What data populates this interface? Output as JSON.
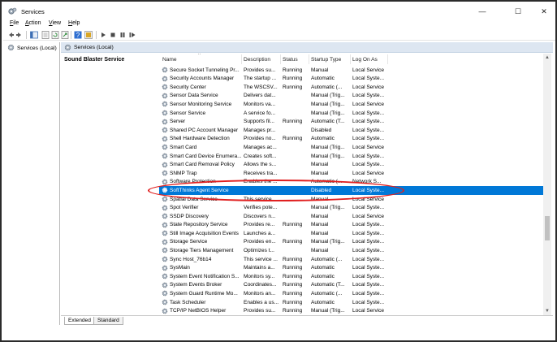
{
  "window": {
    "title": "Services",
    "controls": {
      "minimize": "—",
      "maximize": "☐",
      "close": "✕"
    }
  },
  "menu": [
    {
      "label": "File",
      "key": "F",
      "rest": "ile"
    },
    {
      "label": "Action",
      "key": "A",
      "rest": "ction"
    },
    {
      "label": "View",
      "key": "V",
      "rest": "iew"
    },
    {
      "label": "Help",
      "key": "H",
      "rest": "elp"
    }
  ],
  "tree": {
    "item": "Services (Local)"
  },
  "header_band": {
    "label": "Services (Local)"
  },
  "selected_service_title": "Sound Blaster Service",
  "columns": {
    "name": "Name",
    "description": "Description",
    "status": "Status",
    "startup_type": "Startup Type",
    "log_on_as": "Log On As"
  },
  "rows": [
    {
      "name": "Secure Socket Tunneling Pr...",
      "description": "Provides su...",
      "status": "Running",
      "startup": "Manual",
      "logon": "Local Service"
    },
    {
      "name": "Security Accounts Manager",
      "description": "The startup ...",
      "status": "Running",
      "startup": "Automatic",
      "logon": "Local Syste..."
    },
    {
      "name": "Security Center",
      "description": "The WSCSV...",
      "status": "Running",
      "startup": "Automatic (...",
      "logon": "Local Service"
    },
    {
      "name": "Sensor Data Service",
      "description": "Delivers dat...",
      "status": "",
      "startup": "Manual (Trig...",
      "logon": "Local Syste..."
    },
    {
      "name": "Sensor Monitoring Service",
      "description": "Monitors va...",
      "status": "",
      "startup": "Manual (Trig...",
      "logon": "Local Service"
    },
    {
      "name": "Sensor Service",
      "description": "A service fo...",
      "status": "",
      "startup": "Manual (Trig...",
      "logon": "Local Syste..."
    },
    {
      "name": "Server",
      "description": "Supports fil...",
      "status": "Running",
      "startup": "Automatic (T...",
      "logon": "Local Syste..."
    },
    {
      "name": "Shared PC Account Manager",
      "description": "Manages pr...",
      "status": "",
      "startup": "Disabled",
      "logon": "Local Syste..."
    },
    {
      "name": "Shell Hardware Detection",
      "description": "Provides no...",
      "status": "Running",
      "startup": "Automatic",
      "logon": "Local Syste..."
    },
    {
      "name": "Smart Card",
      "description": "Manages ac...",
      "status": "",
      "startup": "Manual (Trig...",
      "logon": "Local Service"
    },
    {
      "name": "Smart Card Device Enumera...",
      "description": "Creates soft...",
      "status": "",
      "startup": "Manual (Trig...",
      "logon": "Local Syste..."
    },
    {
      "name": "Smart Card Removal Policy",
      "description": "Allows the s...",
      "status": "",
      "startup": "Manual",
      "logon": "Local Syste..."
    },
    {
      "name": "SNMP Trap",
      "description": "Receives tra...",
      "status": "",
      "startup": "Manual",
      "logon": "Local Service"
    },
    {
      "name": "Software Protection",
      "description": "Enables the ...",
      "status": "",
      "startup": "Automatic (...",
      "logon": "Network S..."
    },
    {
      "name": "SoftThinks Agent Service",
      "description": "",
      "status": "",
      "startup": "Disabled",
      "logon": "Local Syste...",
      "selected": true
    },
    {
      "name": "Spatial Data Service",
      "description": "This service ...",
      "status": "",
      "startup": "Manual",
      "logon": "Local Service"
    },
    {
      "name": "Spot Verifier",
      "description": "Verifies pote...",
      "status": "",
      "startup": "Manual (Trig...",
      "logon": "Local Syste..."
    },
    {
      "name": "SSDP Discovery",
      "description": "Discovers n...",
      "status": "",
      "startup": "Manual",
      "logon": "Local Service"
    },
    {
      "name": "State Repository Service",
      "description": "Provides re...",
      "status": "Running",
      "startup": "Manual",
      "logon": "Local Syste..."
    },
    {
      "name": "Still Image Acquisition Events",
      "description": "Launches a...",
      "status": "",
      "startup": "Manual",
      "logon": "Local Syste..."
    },
    {
      "name": "Storage Service",
      "description": "Provides en...",
      "status": "Running",
      "startup": "Manual (Trig...",
      "logon": "Local Syste..."
    },
    {
      "name": "Storage Tiers Management",
      "description": "Optimizes t...",
      "status": "",
      "startup": "Manual",
      "logon": "Local Syste..."
    },
    {
      "name": "Sync Host_76b14",
      "description": "This service ...",
      "status": "Running",
      "startup": "Automatic (...",
      "logon": "Local Syste..."
    },
    {
      "name": "SysMain",
      "description": "Maintains a...",
      "status": "Running",
      "startup": "Automatic",
      "logon": "Local Syste..."
    },
    {
      "name": "System Event Notification S...",
      "description": "Monitors sy...",
      "status": "Running",
      "startup": "Automatic",
      "logon": "Local Syste..."
    },
    {
      "name": "System Events Broker",
      "description": "Coordinates...",
      "status": "Running",
      "startup": "Automatic (T...",
      "logon": "Local Syste..."
    },
    {
      "name": "System Guard Runtime Mo...",
      "description": "Monitors an...",
      "status": "Running",
      "startup": "Automatic (...",
      "logon": "Local Syste..."
    },
    {
      "name": "Task Scheduler",
      "description": "Enables a us...",
      "status": "Running",
      "startup": "Automatic",
      "logon": "Local Syste..."
    },
    {
      "name": "TCP/IP NetBIOS Helper",
      "description": "Provides su...",
      "status": "Running",
      "startup": "Manual (Trig...",
      "logon": "Local Service"
    }
  ],
  "tabs": [
    {
      "label": "Extended",
      "active": true
    },
    {
      "label": "Standard",
      "active": false
    }
  ],
  "colors": {
    "selection": "#0078d7",
    "annotation": "#e02020",
    "header_band": "#dde6f1"
  },
  "icons": {
    "toolbar": [
      "back-arrow-icon",
      "forward-arrow-icon",
      "console-tree-icon",
      "properties-icon",
      "refresh-icon",
      "export-icon",
      "help-icon",
      "help-alt-icon",
      "play-icon",
      "stop-icon",
      "pause-icon",
      "restart-icon"
    ],
    "service": "gear-icon"
  }
}
